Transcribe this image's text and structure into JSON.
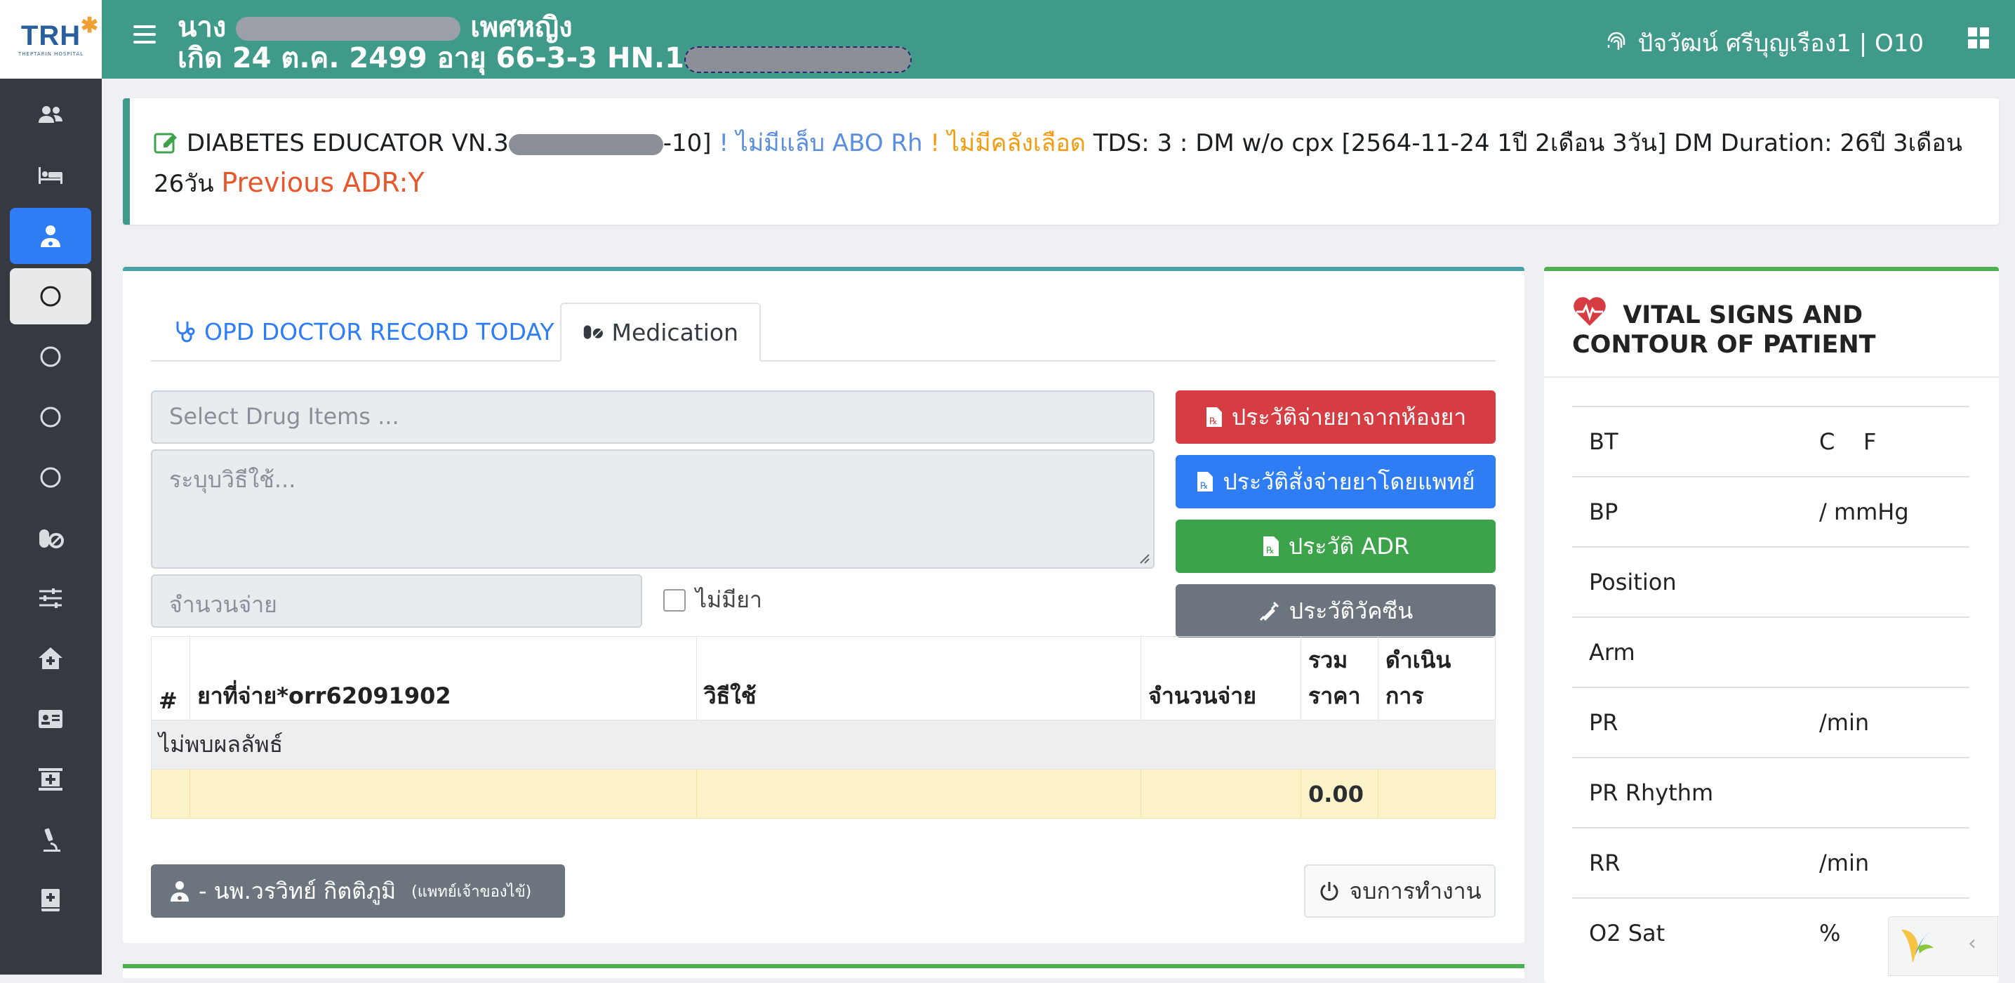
{
  "logo": {
    "title": "TRH",
    "subtitle": "THEPTARIN HOSPITAL"
  },
  "sidebar": {
    "items": [
      {
        "name": "users-icon"
      },
      {
        "name": "bed-icon"
      },
      {
        "name": "doctor-icon",
        "active": true
      },
      {
        "name": "circle-icon",
        "hover": true
      },
      {
        "name": "circle-icon"
      },
      {
        "name": "circle-icon"
      },
      {
        "name": "circle-icon"
      },
      {
        "name": "pills-icon"
      },
      {
        "name": "sliders-icon"
      },
      {
        "name": "clinic-home-icon"
      },
      {
        "name": "id-card-icon"
      },
      {
        "name": "building-icon"
      },
      {
        "name": "microscope-icon"
      },
      {
        "name": "medical-book-icon"
      }
    ]
  },
  "topbar": {
    "prefix": "นาง",
    "gender": "เพศหญิง",
    "line2": "เกิด 24 ต.ค. 2499 อายุ 66-3-3 HN.1",
    "user": "ปัจวัฒน์ ศรีบุญเรือง1 | O10"
  },
  "banner": {
    "part1": "DIABETES EDUCATOR VN.3",
    "part2": "-10]",
    "part3": "! ไม่มีแล็บ ABO Rh",
    "part4": "! ไม่มีคลังเลือด",
    "part5": "TDS: 3 : DM w/o cpx [2564-11-24 1ปี 2เดือน 3วัน] DM Duration: 26ปี 3เดือน 26วัน",
    "part6": "Previous ADR:Y"
  },
  "tabs": {
    "record": "OPD DOCTOR RECORD TODAY",
    "medication": "Medication"
  },
  "form": {
    "drug_placeholder": "Select Drug Items ...",
    "usage_placeholder": "ระบุบวิธีใช้...",
    "qty_placeholder": "จำนวนจ่าย",
    "no_drug": "ไม่มียา"
  },
  "buttons": {
    "pharmacy_history": "ประวัติจ่ายยาจากห้องยา",
    "doctor_history": "ประวัติสั่งจ่ายยาโดยแพทย์",
    "adr_history": "ประวัติ ADR",
    "vaccine_history": "ประวัติวัคซีน"
  },
  "table": {
    "headers": [
      "#",
      "ยาที่จ่าย*orr62091902",
      "วิธีใช้",
      "จำนวนจ่าย",
      "รวม ราคา",
      "ดำเนินการ"
    ],
    "empty": "ไม่พบผลลัพธ์",
    "total": "0.00"
  },
  "footer": {
    "doctor": "- นพ.วรวิทย์ กิตติภูมิ",
    "doctor_role": "(แพทย์เจ้าของไข้)",
    "end": "จบการทำงาน"
  },
  "vitals": {
    "title": "VITAL SIGNS AND CONTOUR OF PATIENT",
    "rows": [
      {
        "label": "BT",
        "value": "C    F"
      },
      {
        "label": "BP",
        "value": "/ mmHg"
      },
      {
        "label": "Position",
        "value": ""
      },
      {
        "label": "Arm",
        "value": ""
      },
      {
        "label": "PR",
        "value": "/min"
      },
      {
        "label": "PR Rhythm",
        "value": ""
      },
      {
        "label": "RR",
        "value": "/min"
      },
      {
        "label": "O2 Sat",
        "value": "%"
      }
    ]
  },
  "colors": {
    "topbar": "#3f9a8a",
    "sidebar": "#343a40",
    "primary": "#2f7df5",
    "danger": "#d63d43",
    "success": "#3ca34a",
    "secondary": "#6c757d"
  }
}
